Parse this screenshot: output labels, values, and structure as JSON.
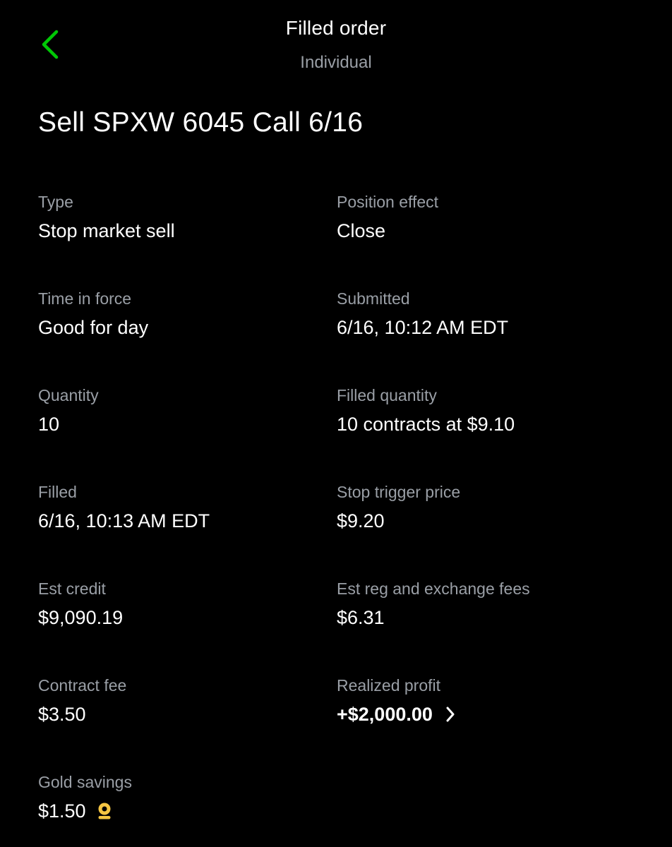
{
  "header": {
    "title": "Filled order",
    "subtitle": "Individual",
    "accent_color": "#00c805"
  },
  "order": {
    "title": "Sell SPXW 6045 Call 6/16"
  },
  "details": {
    "type": {
      "label": "Type",
      "value": "Stop market sell"
    },
    "position_effect": {
      "label": "Position effect",
      "value": "Close"
    },
    "time_in_force": {
      "label": "Time in force",
      "value": "Good for day"
    },
    "submitted": {
      "label": "Submitted",
      "value": "6/16, 10:12 AM EDT"
    },
    "quantity": {
      "label": "Quantity",
      "value": "10"
    },
    "filled_quantity": {
      "label": "Filled quantity",
      "value": "10 contracts at $9.10"
    },
    "filled": {
      "label": "Filled",
      "value": "6/16, 10:13 AM EDT"
    },
    "stop_trigger_price": {
      "label": "Stop trigger price",
      "value": "$9.20"
    },
    "est_credit": {
      "label": "Est credit",
      "value": "$9,090.19"
    },
    "est_fees": {
      "label": "Est reg and exchange fees",
      "value": "$6.31"
    },
    "contract_fee": {
      "label": "Contract fee",
      "value": "$3.50"
    },
    "realized_profit": {
      "label": "Realized profit",
      "value": "+$2,000.00"
    },
    "gold_savings": {
      "label": "Gold savings",
      "value": "$1.50"
    }
  },
  "icons": {
    "back": "chevron-left-icon",
    "profit_detail": "chevron-right-icon",
    "gold": "gold-badge-icon",
    "gold_color": "#f5c542"
  }
}
